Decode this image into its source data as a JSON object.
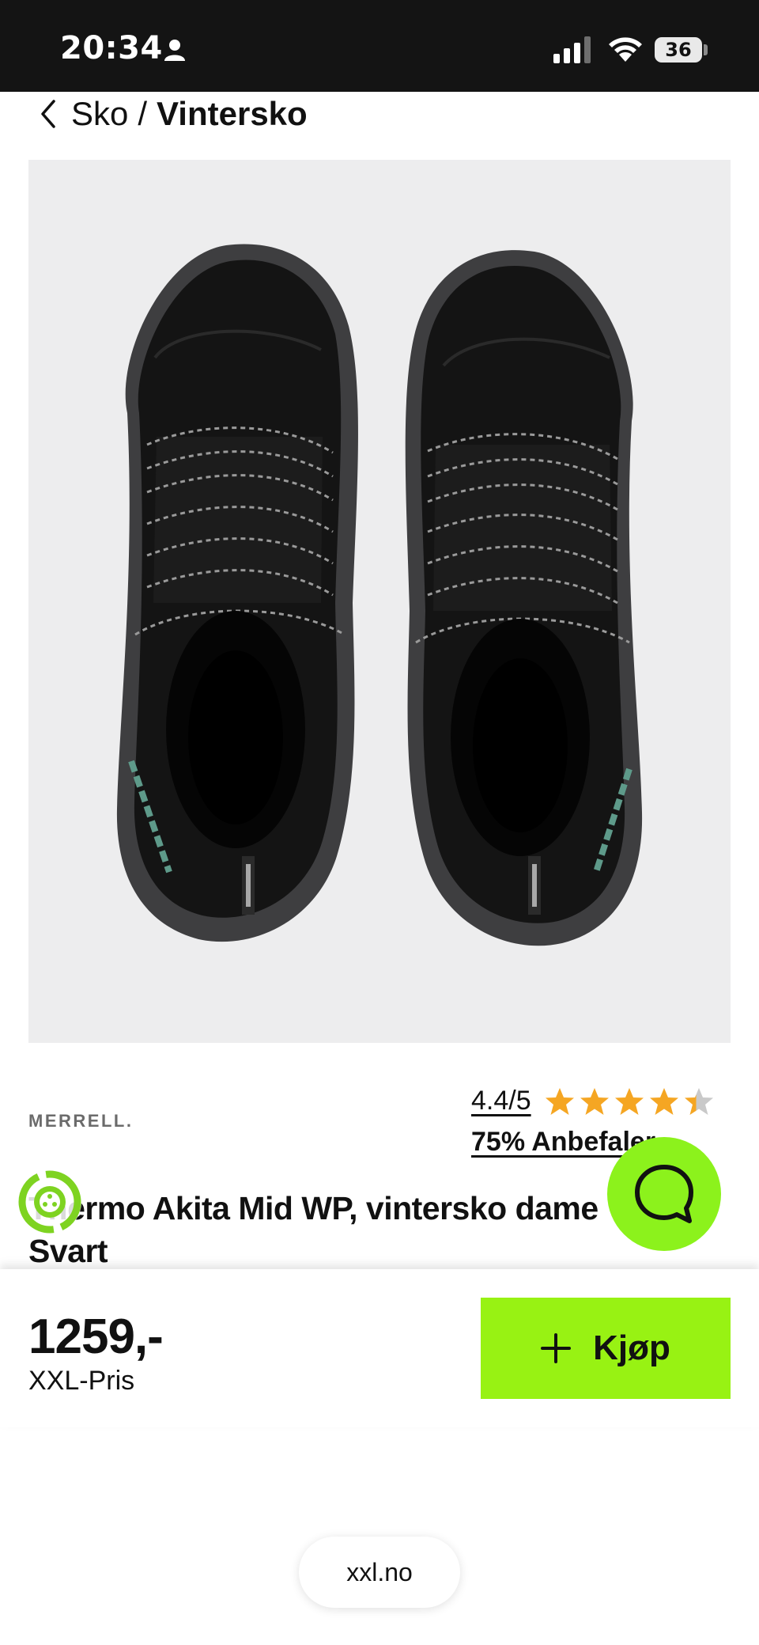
{
  "status_bar": {
    "time": "20:34",
    "battery": "36"
  },
  "breadcrumb": {
    "parent": "Sko",
    "separator": "/",
    "current": "Vintersko"
  },
  "gallery": {
    "image_count": 6,
    "active_index": 2,
    "dot_colors": [
      "#8e8e8e",
      "#636363",
      "#141414",
      "#636363",
      "#8e8e8e",
      "#bdbdbd"
    ]
  },
  "product": {
    "brand": "MERRELL.",
    "rating": "4.4/5",
    "rating_value": 4.4,
    "rating_max": 5,
    "recommend": "75% Anbefaler",
    "title_line1": "Thermo Akita Mid WP, vintersko dame",
    "title_line2": "Svart",
    "price": "1259,-",
    "price_label": "XXL-Pris"
  },
  "actions": {
    "buy_label": "Kjøp"
  },
  "colors": {
    "accent": "#98f213",
    "star": "#f5a623",
    "star_empty": "#c9c9c9"
  },
  "browser": {
    "url": "xxl.no"
  }
}
